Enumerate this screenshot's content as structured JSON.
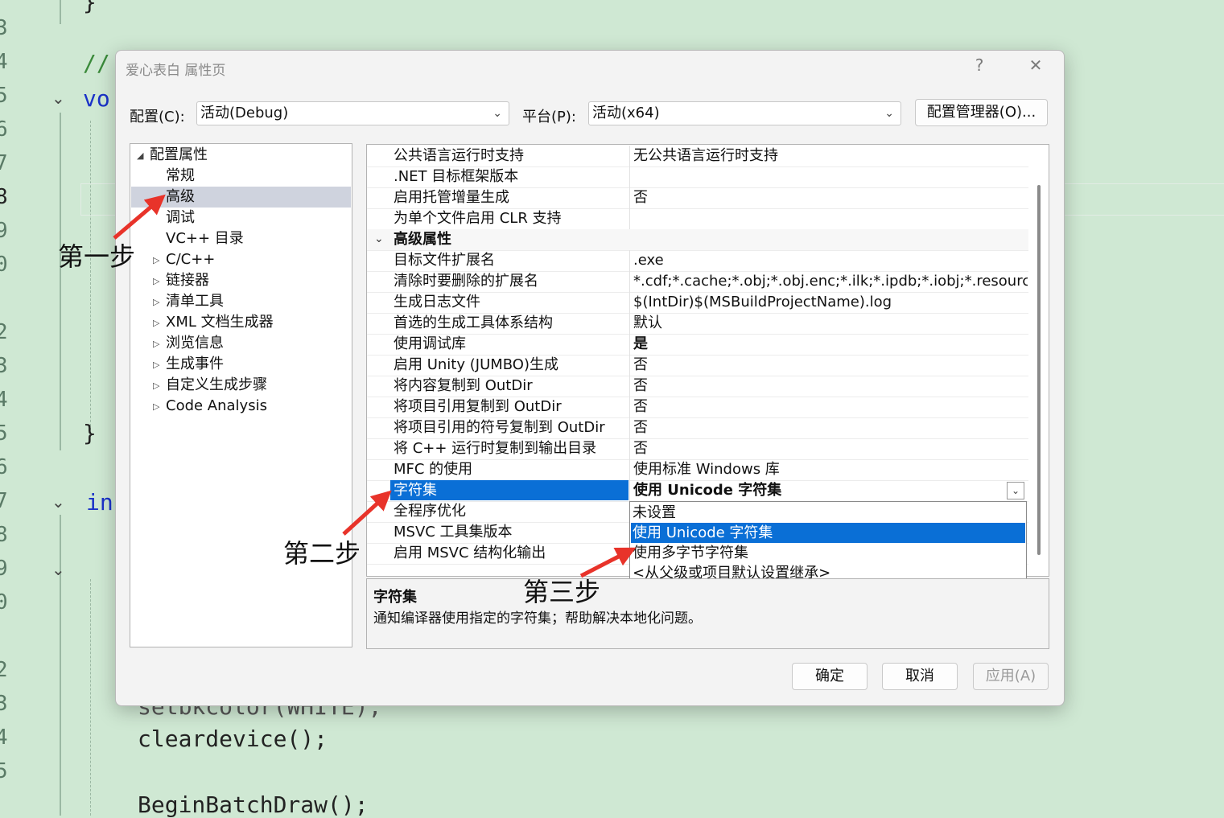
{
  "editor": {
    "line_numbers": [
      "3",
      "4",
      "5",
      "6",
      "7",
      "8",
      "9",
      "0",
      "2",
      "3",
      "4",
      "5",
      "6",
      "7",
      "8",
      "9",
      "0",
      "2",
      "3",
      "4",
      "5"
    ],
    "code": {
      "comment": "//",
      "void_kw": "vo",
      "brace_close": "}",
      "int_kw": "in",
      "setbk": "setbkcolor(WHITE);",
      "clear": "cleardevice();",
      "begin": "BeginBatchDraw();"
    }
  },
  "dialog": {
    "title": "爱心表白 属性页",
    "help_glyph": "?",
    "close_glyph": "✕",
    "config_label": "配置(C):",
    "config_value": "活动(Debug)",
    "platform_label": "平台(P):",
    "platform_value": "活动(x64)",
    "config_manager": "配置管理器(O)...",
    "ok": "确定",
    "cancel": "取消",
    "apply": "应用(A)"
  },
  "tree": {
    "root": "配置属性",
    "items": [
      {
        "label": "常规",
        "expandable": false,
        "selected": false
      },
      {
        "label": "高级",
        "expandable": false,
        "selected": true
      },
      {
        "label": "调试",
        "expandable": false,
        "selected": false
      },
      {
        "label": "VC++ 目录",
        "expandable": false,
        "selected": false
      },
      {
        "label": "C/C++",
        "expandable": true,
        "selected": false
      },
      {
        "label": "链接器",
        "expandable": true,
        "selected": false
      },
      {
        "label": "清单工具",
        "expandable": true,
        "selected": false
      },
      {
        "label": "XML 文档生成器",
        "expandable": true,
        "selected": false
      },
      {
        "label": "浏览信息",
        "expandable": true,
        "selected": false
      },
      {
        "label": "生成事件",
        "expandable": true,
        "selected": false
      },
      {
        "label": "自定义生成步骤",
        "expandable": true,
        "selected": false
      },
      {
        "label": "Code Analysis",
        "expandable": true,
        "selected": false
      }
    ]
  },
  "grid": {
    "rows": [
      {
        "name": "公共语言运行时支持",
        "value": "无公共语言运行时支持"
      },
      {
        "name": ".NET 目标框架版本",
        "value": ""
      },
      {
        "name": "启用托管增量生成",
        "value": "否"
      },
      {
        "name": "为单个文件启用 CLR 支持",
        "value": ""
      },
      {
        "name": "高级属性",
        "value": "",
        "category": true
      },
      {
        "name": "目标文件扩展名",
        "value": ".exe"
      },
      {
        "name": "清除时要删除的扩展名",
        "value": "*.cdf;*.cache;*.obj;*.obj.enc;*.ilk;*.ipdb;*.iobj;*.resources;*.tl"
      },
      {
        "name": "生成日志文件",
        "value": "$(IntDir)$(MSBuildProjectName).log"
      },
      {
        "name": "首选的生成工具体系结构",
        "value": "默认"
      },
      {
        "name": "使用调试库",
        "value": "是",
        "bold": true
      },
      {
        "name": "启用 Unity (JUMBO)生成",
        "value": "否"
      },
      {
        "name": "将内容复制到 OutDir",
        "value": "否"
      },
      {
        "name": "将项目引用复制到 OutDir",
        "value": "否"
      },
      {
        "name": "将项目引用的符号复制到 OutDir",
        "value": "否"
      },
      {
        "name": "将 C++ 运行时复制到输出目录",
        "value": "否"
      },
      {
        "name": "MFC 的使用",
        "value": "使用标准 Windows 库"
      },
      {
        "name": "字符集",
        "value": "使用 Unicode 字符集",
        "bold": true,
        "selected": true
      },
      {
        "name": "全程序优化",
        "value": ""
      },
      {
        "name": "MSVC 工具集版本",
        "value": ""
      },
      {
        "name": "启用 MSVC 结构化输出",
        "value": ""
      }
    ],
    "dropdown_chevron": "⌄"
  },
  "dropdown": {
    "options": [
      "未设置",
      "使用 Unicode 字符集",
      "使用多字节字符集",
      "<从父级或项目默认设置继承>"
    ],
    "highlighted_index": 1
  },
  "description": {
    "title": "字符集",
    "text": "通知编译器使用指定的字符集；帮助解决本地化问题。"
  },
  "annotations": {
    "step1": "第一步",
    "step2": "第二步",
    "step3": "第三步",
    "arrow_color": "#e8332a"
  }
}
